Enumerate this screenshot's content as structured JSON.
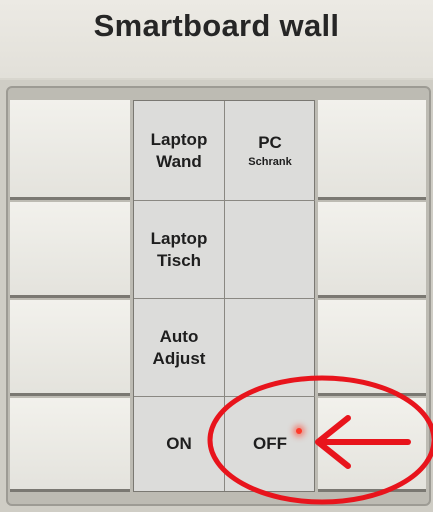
{
  "panel": {
    "title": "Smartboard wall",
    "buttons": {
      "laptop_wand": {
        "line1": "Laptop",
        "line2": "Wand"
      },
      "pc_schrank": {
        "line1": "PC",
        "line2": "Schrank"
      },
      "laptop_tisch": {
        "line1": "Laptop",
        "line2": "Tisch"
      },
      "auto_adjust": {
        "line1": "Auto",
        "line2": "Adjust"
      },
      "on": {
        "label": "ON"
      },
      "off": {
        "label": "OFF"
      }
    }
  },
  "annotation": {
    "color": "#e8141c",
    "shape": "circle-and-arrow",
    "target": "off-button"
  }
}
